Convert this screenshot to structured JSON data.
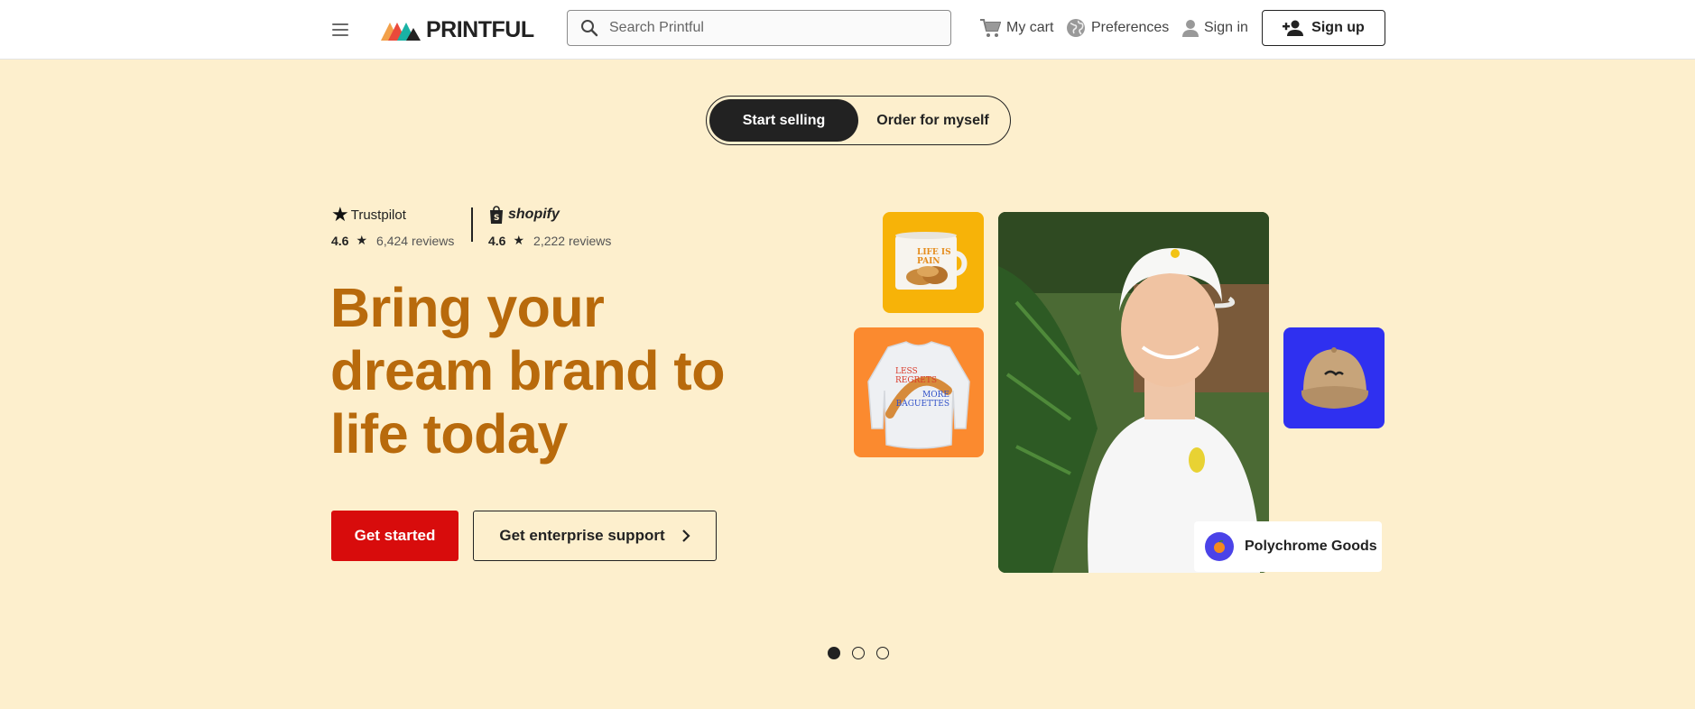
{
  "header": {
    "logo_text": "PRINTFUL",
    "search_placeholder": "Search Printful",
    "cart_label": "My cart",
    "preferences_label": "Preferences",
    "signin_label": "Sign in",
    "signup_label": "Sign up"
  },
  "toggle": {
    "start_selling": "Start selling",
    "order_for_myself": "Order for myself"
  },
  "ratings": {
    "trustpilot": {
      "name": "Trustpilot",
      "score": "4.6",
      "reviews": "6,424 reviews"
    },
    "shopify": {
      "name": "shopify",
      "score": "4.6",
      "reviews": "2,222 reviews"
    }
  },
  "hero": {
    "title_line1": "Bring your",
    "title_line2": "dream brand to",
    "title_line3": "life today",
    "get_started": "Get started",
    "enterprise": "Get enterprise support"
  },
  "products": {
    "mug_text": "LIFE IS PAIN",
    "sweat_line1": "LESS",
    "sweat_line2": "REGRETS",
    "sweat_line3": "MORE",
    "sweat_line4": "BAGUETTES",
    "brand_tag": "Polychrome Goods"
  },
  "carousel": {
    "active_index": 1,
    "total": 3
  },
  "colors": {
    "background": "#fdefcd",
    "headline": "#b86a0c",
    "primary_button": "#d80c0c",
    "mug_tile": "#f7b308",
    "sweat_tile": "#fb8a2f",
    "hat_tile": "#2f30f0"
  },
  "icons": [
    "menu-icon",
    "search-icon",
    "cart-icon",
    "globe-icon",
    "user-icon",
    "add-user-icon",
    "star-icon",
    "shopify-bag-icon",
    "chevron-right-icon",
    "orange-icon"
  ]
}
